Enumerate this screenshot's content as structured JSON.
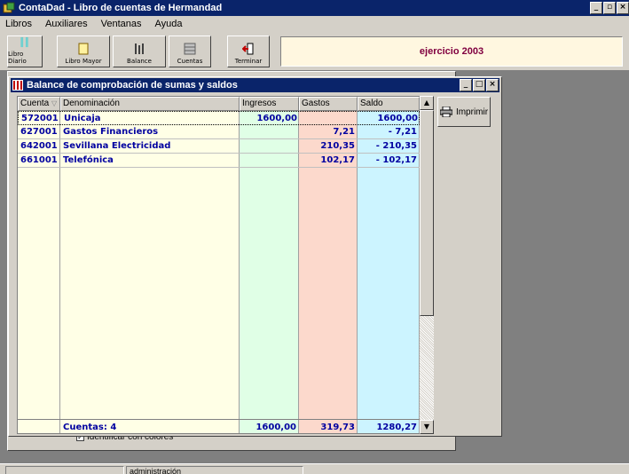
{
  "window": {
    "title": "ContaDad - Libro de cuentas de Hermandad"
  },
  "menu": [
    "Libros",
    "Auxiliares",
    "Ventanas",
    "Ayuda"
  ],
  "toolbar": {
    "buttons": [
      "Libro Diario",
      "Libro Mayor",
      "Balance",
      "Cuentas",
      "Terminar"
    ],
    "exercise": "ejercicio 2003"
  },
  "balance": {
    "title": "Balance de comprobación de sumas y saldos",
    "columns": [
      "Cuenta",
      "Denominación",
      "Ingresos",
      "Gastos",
      "Saldo"
    ],
    "rows": [
      {
        "cuenta": "572001",
        "denominacion": "Unicaja",
        "ingresos": "1600,00",
        "gastos": "",
        "saldo": "1600,00"
      },
      {
        "cuenta": "627001",
        "denominacion": "Gastos Financieros",
        "ingresos": "",
        "gastos": "7,21",
        "saldo": "- 7,21"
      },
      {
        "cuenta": "642001",
        "denominacion": "Sevillana Electricidad",
        "ingresos": "",
        "gastos": "210,35",
        "saldo": "- 210,35"
      },
      {
        "cuenta": "661001",
        "denominacion": "Telefónica",
        "ingresos": "",
        "gastos": "102,17",
        "saldo": "- 102,17"
      }
    ],
    "footer": {
      "label": "Cuentas: 4",
      "ingresos": "1600,00",
      "gastos": "319,73",
      "saldo": "1280,27"
    },
    "print_label": "Imprimir"
  },
  "identify_colors": "Identificar con colores",
  "status": {
    "user": "administración"
  },
  "colors": {
    "title_bg": "#0a246a",
    "accent": "#800040",
    "value_text": "#0000a0"
  }
}
